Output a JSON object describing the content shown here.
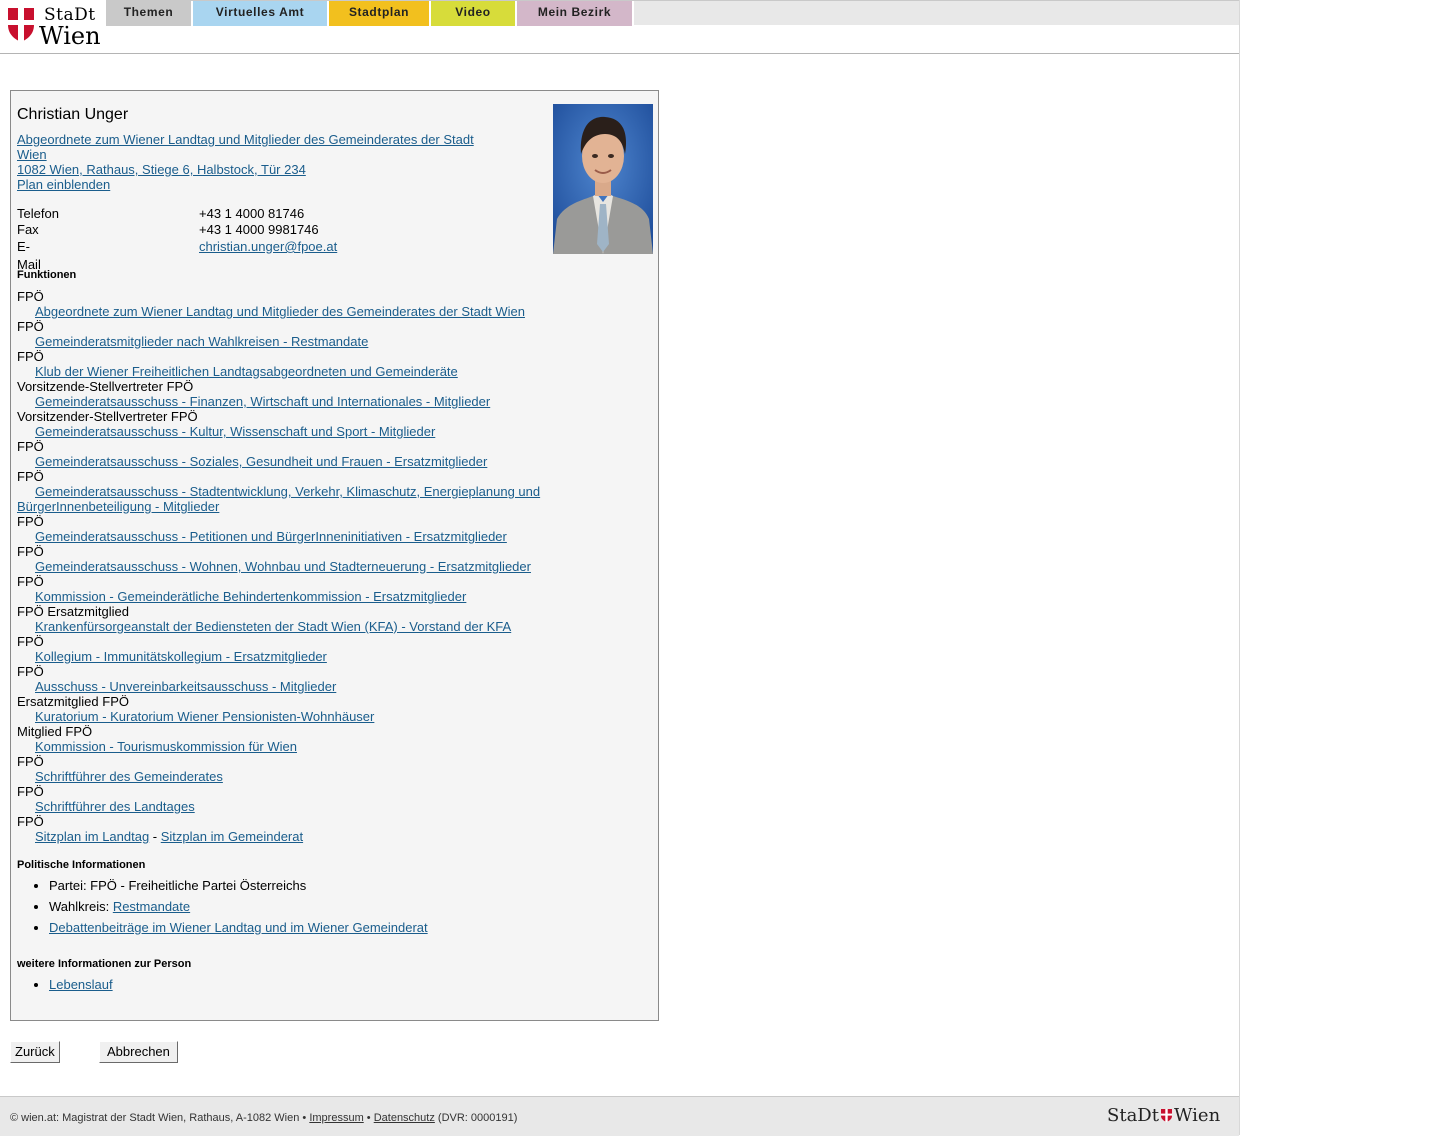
{
  "brand": {
    "line1": "StaDt",
    "line2": "Wien"
  },
  "nav": [
    "Themen",
    "Virtuelles Amt",
    "Stadtplan",
    "Video",
    "Mein Bezirk"
  ],
  "nav_colors": [
    "#c9c9c9",
    "#a9d5f0",
    "#f2c01e",
    "#d7dc3a",
    "#d3b7c9"
  ],
  "person": {
    "name": "Christian Unger",
    "title_link": "Abgeordnete zum Wiener Landtag und Mitglieder des Gemeinderates der Stadt Wien",
    "address_link": "1082 Wien, Rathaus, Stiege 6, Halbstock, Tür 234",
    "map_link": "Plan einblenden"
  },
  "contacts": [
    {
      "label": "Telefon",
      "value": "+43 1 4000 81746"
    },
    {
      "label": "Fax",
      "value": "+43 1 4000 9981746"
    },
    {
      "label": "E-Mail",
      "value": "christian.unger@fpoe.at"
    }
  ],
  "sections": {
    "funktionen": "Funktionen",
    "politisch": "Politische Informationen",
    "weitere": "weitere Informationen zur Person"
  },
  "functions": [
    {
      "role": "FPÖ",
      "link": "Abgeordnete zum Wiener Landtag und Mitglieder des Gemeinderates der Stadt Wien"
    },
    {
      "role": "FPÖ",
      "link": "Gemeinderatsmitglieder nach Wahlkreisen - Restmandate"
    },
    {
      "role": "FPÖ",
      "link": "Klub der Wiener Freiheitlichen Landtagsabgeordneten und Gemeinderäte"
    },
    {
      "role": "Vorsitzende-Stellvertreter FPÖ",
      "link": "Gemeinderatsausschuss - Finanzen, Wirtschaft und Internationales - Mitglieder"
    },
    {
      "role": "Vorsitzender-Stellvertreter FPÖ",
      "link": "Gemeinderatsausschuss - Kultur, Wissenschaft und Sport - Mitglieder"
    },
    {
      "role": "FPÖ",
      "link": "Gemeinderatsausschuss - Soziales, Gesundheit und Frauen - Ersatzmitglieder"
    },
    {
      "role": "FPÖ",
      "link": "Gemeinderatsausschuss - Stadtentwicklung, Verkehr, Klimaschutz, Energieplanung und BürgerInnenbeteiligung - Mitglieder"
    },
    {
      "role": "FPÖ",
      "link": "Gemeinderatsausschuss - Petitionen und BürgerInneninitiativen - Ersatzmitglieder"
    },
    {
      "role": "FPÖ",
      "link": "Gemeinderatsausschuss - Wohnen, Wohnbau und Stadterneuerung - Ersatzmitglieder"
    },
    {
      "role": "FPÖ",
      "link": "Kommission - Gemeinderätliche Behindertenkommission - Ersatzmitglieder"
    },
    {
      "role": "FPÖ Ersatzmitglied",
      "link": "Krankenfürsorgeanstalt der Bediensteten der Stadt Wien (KFA) - Vorstand der KFA"
    },
    {
      "role": "FPÖ",
      "link": "Kollegium - Immunitätskollegium - Ersatzmitglieder"
    },
    {
      "role": "FPÖ",
      "link": "Ausschuss - Unvereinbarkeitsausschuss - Mitglieder"
    },
    {
      "role": "Ersatzmitglied FPÖ",
      "link": "Kuratorium - Kuratorium Wiener Pensionisten-Wohnhäuser"
    },
    {
      "role": "Mitglied FPÖ",
      "link": "Kommission - Tourismuskommission für Wien"
    },
    {
      "role": "FPÖ",
      "link": "Schriftführer des Gemeinderates"
    },
    {
      "role": "FPÖ",
      "link": "Schriftführer des Landtages"
    }
  ],
  "seating": {
    "role": "FPÖ",
    "link1": "Sitzplan im Landtag",
    "sep": " - ",
    "link2": "Sitzplan im Gemeinderat"
  },
  "political": {
    "partei": "Partei: FPÖ - Freiheitliche Partei Österreichs",
    "wahlkreis_label": "Wahlkreis: ",
    "wahlkreis_link": "Restmandate",
    "debatten": "Debattenbeiträge im Wiener Landtag und im Wiener Gemeinderat"
  },
  "weitere": {
    "lebenslauf": "Lebenslauf"
  },
  "buttons": {
    "back": "Zurück",
    "cancel": "Abbrechen"
  },
  "footer": {
    "copyright": "© wien.at: Magistrat der Stadt Wien, Rathaus, A-1082 Wien",
    "bullet": " • ",
    "impressum": "Impressum",
    "datenschutz": "Datenschutz",
    "dvr": " (DVR: 0000191)",
    "logo1": "StaDt",
    "logo2": "Wien"
  }
}
